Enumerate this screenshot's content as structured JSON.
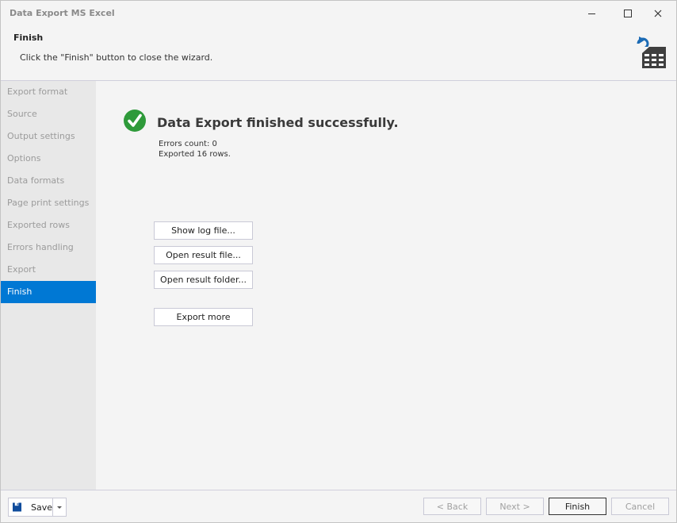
{
  "window": {
    "title": "Data Export MS Excel",
    "controls": {
      "minimize": "minimize-icon",
      "maximize": "maximize-icon",
      "close": "close-icon"
    }
  },
  "header": {
    "title": "Finish",
    "description": "Click the \"Finish\" button to close the wizard.",
    "icon": "export-table-icon"
  },
  "sidebar": {
    "items": [
      {
        "label": "Export format",
        "active": false
      },
      {
        "label": "Source",
        "active": false
      },
      {
        "label": "Output settings",
        "active": false
      },
      {
        "label": "Options",
        "active": false
      },
      {
        "label": "Data formats",
        "active": false
      },
      {
        "label": "Page print settings",
        "active": false
      },
      {
        "label": "Exported rows",
        "active": false
      },
      {
        "label": "Errors handling",
        "active": false
      },
      {
        "label": "Export",
        "active": false
      },
      {
        "label": "Finish",
        "active": true
      }
    ],
    "active_color": "#0078d4"
  },
  "main": {
    "status_icon": "success-check-icon",
    "status_color": "#2e9a3a",
    "title": "Data Export finished successfully.",
    "errors_count": "Errors count: 0",
    "exported_rows": "Exported 16 rows.",
    "actions": {
      "show_log": "Show log file...",
      "open_file": "Open result file...",
      "open_folder": "Open result folder...",
      "export_more": "Export more"
    }
  },
  "footer": {
    "save_label": "Save",
    "back_label": "< Back",
    "next_label": "Next >",
    "finish_label": "Finish",
    "cancel_label": "Cancel"
  }
}
